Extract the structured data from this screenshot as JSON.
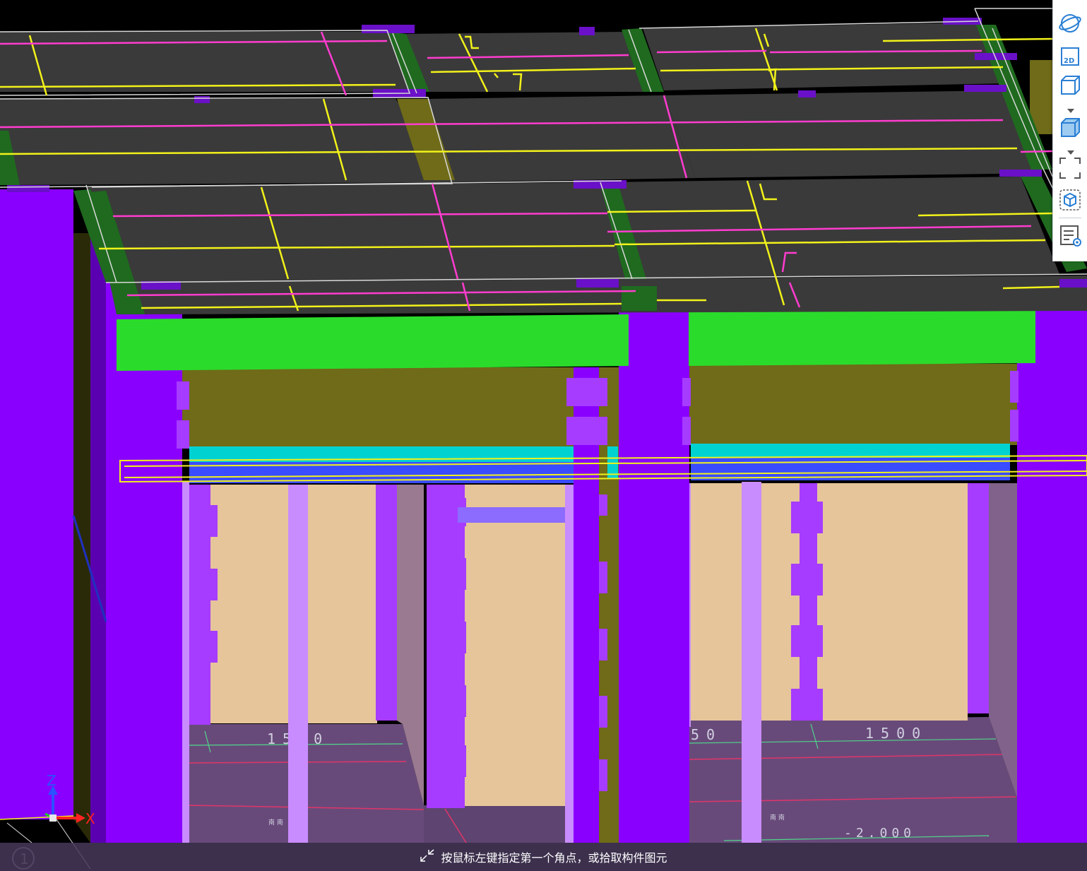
{
  "status_hint": "按鼠标左键指定第一个角点，或拾取构件图元",
  "icons": {
    "orbit": "orbit-icon",
    "view_2d": "2d-view-icon",
    "view_3d_wire": "3d-wireframe-icon",
    "view_3d_solid": "3d-solid-icon",
    "zoom_extents": "zoom-extents-icon",
    "dynamic_observe": "dynamic-observe-icon",
    "properties": "display-settings-icon",
    "corner_select": "corner-select-icon"
  },
  "toolbar": {
    "view_2d_label": "2D"
  },
  "axis": {
    "z_label": "Z",
    "x_label": "X"
  },
  "view_number": "1",
  "dimensions": {
    "left_dim": "1500",
    "mid_dim": "50",
    "right_dim": "1500",
    "elevation": "-2.000",
    "left_tag": "南 南",
    "right_tag": "南 南"
  },
  "colors": {
    "background": "#000000",
    "column": "#8a00ff",
    "column_light": "#b03cff",
    "beam_green": "#2bdb2b",
    "slab_dark": "#3a3a3a",
    "slab_edge": "#1f6a1f",
    "wall_olive": "#6f6b18",
    "wall_tan": "#e6c59a",
    "floor": "#684a7a",
    "rebar_yellow": "#f2f21a",
    "rebar_magenta": "#ff3ccf",
    "cyan": "#00d2d2",
    "blue": "#3a4cff",
    "pier_light": "#c98cff"
  }
}
